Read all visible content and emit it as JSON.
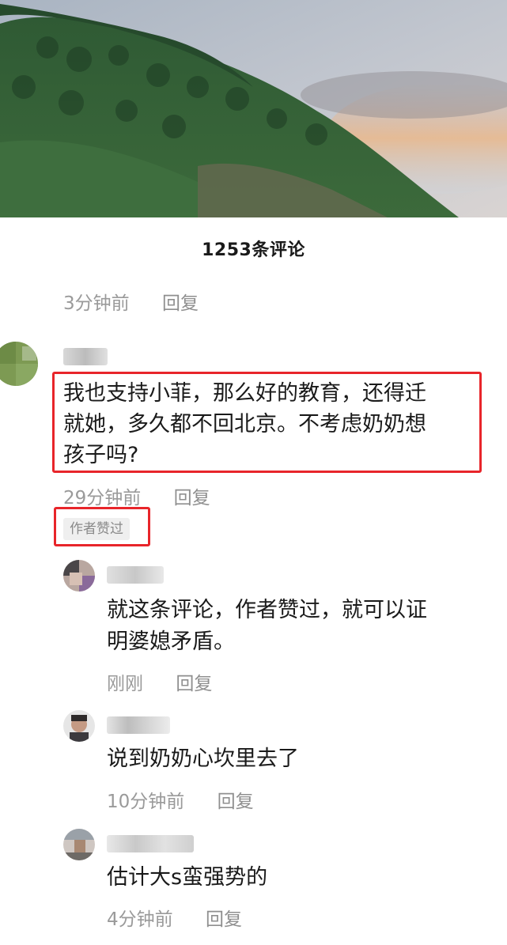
{
  "comments_header": {
    "count_label": "1253条评论"
  },
  "prev_comment_meta": {
    "time": "3分钟前",
    "reply": "回复"
  },
  "main_comment": {
    "text_line1": "我也支持小菲，那么好的教育，还得迁",
    "text_line2": "就她，多久都不回北京。不考虑奶奶想",
    "text_line3": "孩子吗?",
    "time": "29分钟前",
    "reply": "回复",
    "author_liked_badge": "作者赞过"
  },
  "replies": [
    {
      "text_line1": "就这条评论，作者赞过，就可以证",
      "text_line2": "明婆媳矛盾。",
      "time": "刚刚",
      "reply": "回复"
    },
    {
      "text_line1": "说到奶奶心坎里去了",
      "time": "10分钟前",
      "reply": "回复"
    },
    {
      "text_line1": "估计大s蛮强势的",
      "time": "4分钟前",
      "reply": "回复"
    }
  ],
  "colors": {
    "highlight_red": "#e8252a",
    "muted_gray": "#9a9a9a"
  }
}
